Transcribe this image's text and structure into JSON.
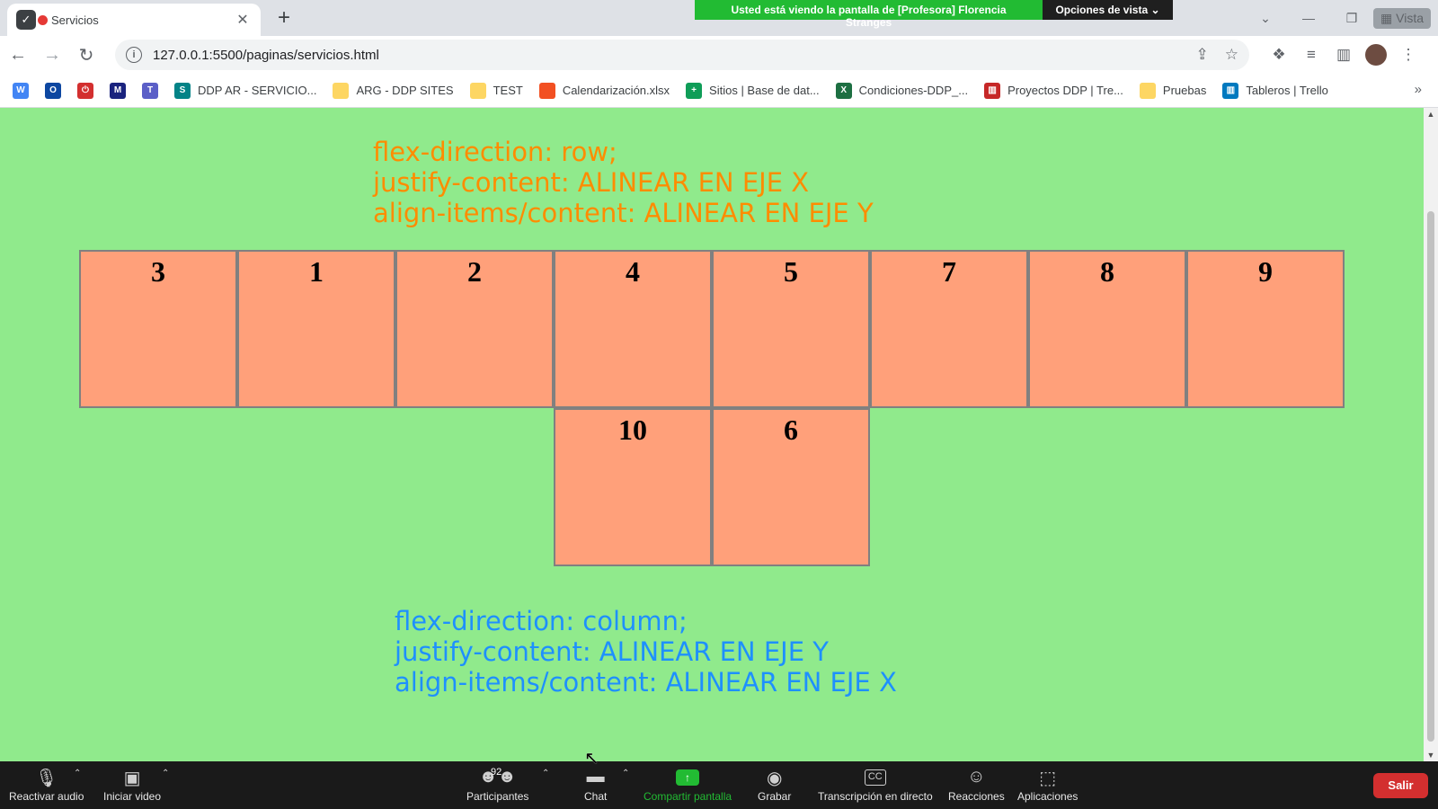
{
  "browser": {
    "tab_title": "Servicios",
    "tab_favicon": "shield-icon",
    "screen_share_banner": "Usted está viendo la pantalla de [Profesora] Florencia Stranges",
    "view_options_label": "Opciones de vista",
    "view_button_label": "Vista",
    "url": "127.0.0.1:5500/paginas/servicios.html",
    "bookmarks": [
      {
        "label": "",
        "icon": "w-icon",
        "color": "#4285f4"
      },
      {
        "label": "",
        "icon": "o-icon",
        "color": "#0d47a1"
      },
      {
        "label": "",
        "icon": "power-icon",
        "color": "#d32f2f"
      },
      {
        "label": "",
        "icon": "m-icon",
        "color": "#1a237e"
      },
      {
        "label": "",
        "icon": "teams-icon",
        "color": "#5b5fc7"
      },
      {
        "label": "DDP AR - SERVICIO...",
        "icon": "sharepoint-icon",
        "color": "#038387"
      },
      {
        "label": "ARG - DDP SITES",
        "icon": "folder-icon",
        "color": "#fdd663"
      },
      {
        "label": "TEST",
        "icon": "folder-icon",
        "color": "#fdd663"
      },
      {
        "label": "Calendarización.xlsx",
        "icon": "microsoft-icon",
        "color": "#f25022"
      },
      {
        "label": "Sitios | Base de dat...",
        "icon": "sheets-icon",
        "color": "#0f9d58"
      },
      {
        "label": "Condiciones-DDP_...",
        "icon": "excel-icon",
        "color": "#1d6f42"
      },
      {
        "label": "Proyectos DDP | Tre...",
        "icon": "trello-icon",
        "color": "#c62828"
      },
      {
        "label": "Pruebas",
        "icon": "folder-icon",
        "color": "#fdd663"
      },
      {
        "label": "Tableros | Trello",
        "icon": "trello-icon",
        "color": "#0079bf"
      }
    ]
  },
  "page": {
    "background": "#90ea8c",
    "note_top": {
      "color": "#ff8c00",
      "lines": [
        "flex-direction: row;",
        "justify-content: ALINEAR EN EJE X",
        "align-items/content: ALINEAR EN EJE Y"
      ]
    },
    "boxes_row1": [
      "3",
      "1",
      "2",
      "4",
      "5",
      "7",
      "8",
      "9"
    ],
    "boxes_row2": [
      "10",
      "6"
    ],
    "box_color": "#ffa07a",
    "note_bottom": {
      "color": "#1e90ff",
      "lines": [
        "flex-direction: column;",
        "justify-content: ALINEAR EN EJE Y",
        "align-items/content: ALINEAR EN EJE X"
      ]
    }
  },
  "meeting": {
    "mute_label": "Reactivar audio",
    "video_label": "Iniciar video",
    "participants_label": "Participantes",
    "participants_count": "92",
    "chat_label": "Chat",
    "share_label": "Compartir pantalla",
    "record_label": "Grabar",
    "transcript_label": "Transcripción en directo",
    "reactions_label": "Reacciones",
    "apps_label": "Aplicaciones",
    "leave_label": "Salir"
  }
}
